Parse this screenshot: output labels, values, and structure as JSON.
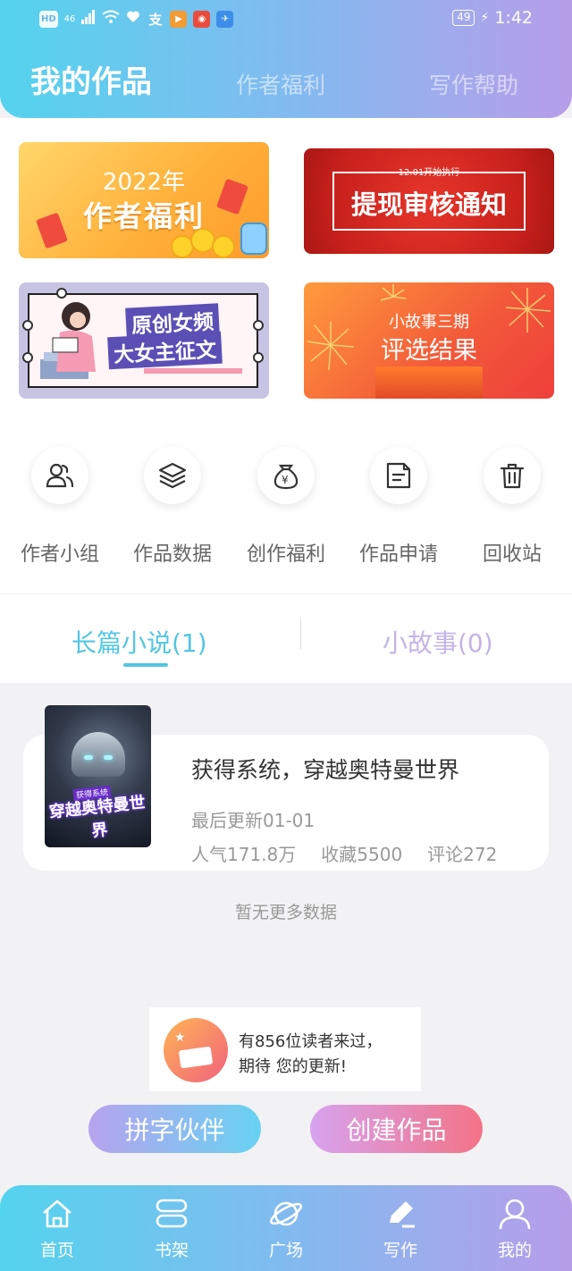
{
  "status_bar": {
    "network": "HD",
    "signal": "46",
    "battery": "49",
    "time": "1:42"
  },
  "header": {
    "tabs": [
      {
        "label": "我的作品",
        "active": true
      },
      {
        "label": "作者福利",
        "active": false
      },
      {
        "label": "写作帮助",
        "active": false
      }
    ]
  },
  "banners": [
    {
      "year": "2022年",
      "title": "作者福利"
    },
    {
      "small": "12.01开始执行",
      "title": "提现审核通知"
    },
    {
      "line1": "原创女频",
      "line2": "大女主征文"
    },
    {
      "line1": "小故事三期",
      "line2": "评选结果"
    }
  ],
  "quick_menu": [
    {
      "label": "作者小组",
      "icon": "people-icon"
    },
    {
      "label": "作品数据",
      "icon": "layers-icon"
    },
    {
      "label": "创作福利",
      "icon": "money-bag-icon"
    },
    {
      "label": "作品申请",
      "icon": "document-icon"
    },
    {
      "label": "回收站",
      "icon": "trash-icon"
    }
  ],
  "works_tabs": [
    {
      "label": "长篇小说(1)",
      "active": true
    },
    {
      "label": "小故事(0)",
      "active": false
    }
  ],
  "book": {
    "title": "获得系统，穿越奥特曼世界",
    "cover_tag": "获得系统",
    "cover_text": "穿越奥特曼世界",
    "last_update": "最后更新01-01",
    "popularity": "人气171.8万",
    "favorites": "收藏5500",
    "comments": "评论272"
  },
  "no_more": "暂无更多数据",
  "notice": {
    "line1": "有856位读者来过，",
    "line2": "期待 您的更新!"
  },
  "buttons": {
    "partner": "拼字伙伴",
    "create": "创建作品"
  },
  "bottom_nav": [
    {
      "label": "首页",
      "icon": "home-icon"
    },
    {
      "label": "书架",
      "icon": "bookshelf-icon"
    },
    {
      "label": "广场",
      "icon": "planet-icon"
    },
    {
      "label": "写作",
      "icon": "pen-icon",
      "active": true
    },
    {
      "label": "我的",
      "icon": "user-icon"
    }
  ],
  "colors": {
    "accent": "#53c6e2",
    "accent_secondary": "#c3b4e6",
    "create_button": "#f37387"
  }
}
